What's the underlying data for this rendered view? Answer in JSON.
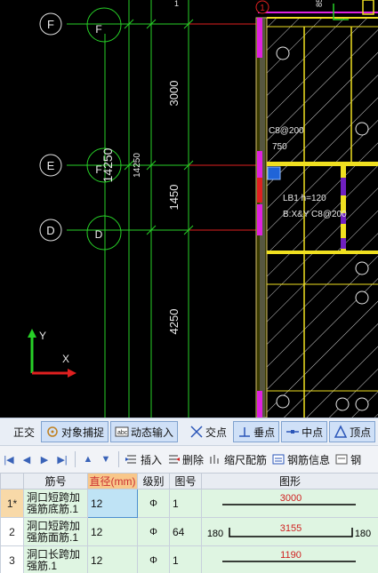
{
  "cad": {
    "axis_labels": [
      "F",
      "E",
      "D"
    ],
    "axis_labels_inner": [
      "F",
      "F",
      "D"
    ],
    "top_marker": "1",
    "dims": [
      "3000",
      "1450",
      "4250",
      "14250",
      "14250"
    ],
    "beam_text": [
      "C8@200",
      "750",
      "LB1 h=120",
      "B:X&Y C8@200"
    ],
    "ucs": {
      "y": "Y",
      "x": "X"
    },
    "top_fragments": [
      "1",
      "85"
    ]
  },
  "snapbar": {
    "ortho": "正交",
    "object_snap": "对象捕捉",
    "dynamic_input": "动态输入",
    "intersection": "交点",
    "perpendicular": "垂点",
    "midpoint": "中点",
    "vertex": "顶点"
  },
  "rebartool": {
    "insert": "插入",
    "delete": "删除",
    "scale_rebar": "缩尺配筋",
    "rebar_info": "钢筋信息",
    "more": "钢"
  },
  "table": {
    "headers": [
      "筋号",
      "直径(mm)",
      "级别",
      "图号",
      "图形"
    ],
    "rows": [
      {
        "num": "1*",
        "name": "洞口短跨加强筋底筋.1",
        "dia": "12",
        "grade": "Φ",
        "fig": "1",
        "shape_main": "3000",
        "left": "",
        "right": ""
      },
      {
        "num": "2",
        "name": "洞口短跨加强筋面筋.1",
        "dia": "12",
        "grade": "Φ",
        "fig": "64",
        "shape_main": "3155",
        "left": "180",
        "right": "180"
      },
      {
        "num": "3",
        "name": "洞口长跨加强筋.1",
        "dia": "12",
        "grade": "Φ",
        "fig": "1",
        "shape_main": "1190",
        "left": "",
        "right": ""
      }
    ]
  },
  "colors": {
    "axis_green": "#27d027",
    "axis_circle": "#e0e0e0",
    "wall_magenta": "#e020e0",
    "beam_yellow": "#f0e020",
    "hatch": "#d8d8d8",
    "accent_blue": "#1f64d8",
    "red": "#e02020"
  }
}
